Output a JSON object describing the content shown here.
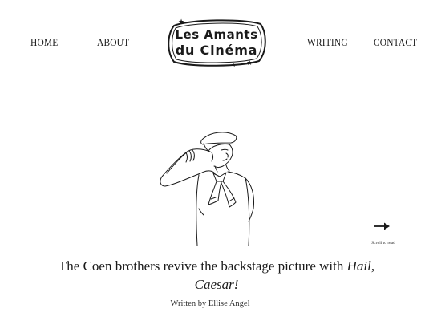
{
  "nav": {
    "home": "HOME",
    "about": "ABOUT",
    "writing": "WRITING",
    "contact": "CONTACT"
  },
  "logo": {
    "line1": "Les Amants",
    "line2": "du Cinéma"
  },
  "hero": {
    "illustration": "sailor-saluting-drawing"
  },
  "scroll": {
    "label": "Scroll to read",
    "icon": "arrow-right-icon"
  },
  "article": {
    "headline_plain": "The Coen brothers revive the backstage picture with ",
    "headline_italic": "Hail, Caesar!",
    "byline": "Written by Ellise Angel"
  },
  "colors": {
    "background": "#ffffff",
    "text": "#1a1a1a"
  }
}
